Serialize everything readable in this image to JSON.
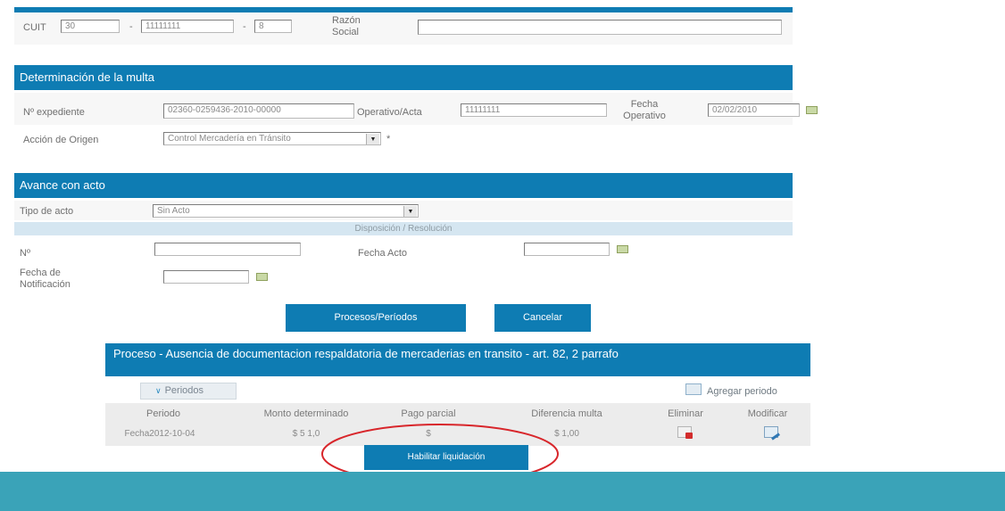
{
  "cuit_section": {
    "cuit_label": "CUIT",
    "cuit_part1": "30",
    "cuit_part2": "11111111",
    "cuit_part3": "8",
    "sep": "-",
    "razon_label": "Razón Social",
    "razon_value": ""
  },
  "multa_section": {
    "title": "Determinación de la multa",
    "expediente_label": "Nº expediente",
    "expediente_value": "02360-0259436-2010-00000",
    "operativo_label": "Operativo/Acta",
    "operativo_value": "11111111",
    "fecha_operativo_label": "Fecha Operativo",
    "fecha_operativo_value": "02/02/2010",
    "accion_label": "Acción de Origen",
    "accion_value": "Control Mercadería en Tránsito",
    "required_mark": "*"
  },
  "avance_section": {
    "title": "Avance con acto",
    "tipo_label": "Tipo de acto",
    "tipo_value": "Sin Acto",
    "subheader": "Disposición / Resolución",
    "numero_label": "Nº",
    "numero_value": "",
    "fecha_acto_label": "Fecha Acto",
    "fecha_acto_value": "",
    "fecha_notif_label": "Fecha de Notificación",
    "fecha_notif_value": ""
  },
  "actions": {
    "procesos_label": "Procesos/Períodos",
    "cancelar_label": "Cancelar"
  },
  "proceso_panel": {
    "title": "Proceso - Ausencia de documentacion respaldatoria de mercaderias en transito - art. 82, 2 parrafo",
    "periodos_toggle": "Periodos",
    "agregar_label": "Agregar periodo",
    "columns": [
      "Periodo",
      "Monto determinado",
      "Pago parcial",
      "Diferencia multa",
      "Eliminar",
      "Modificar"
    ],
    "rows": [
      {
        "periodo": "Fecha2012-10-04",
        "monto": "$ 5 1,0",
        "pago": "$",
        "diferencia": "$ 1,00"
      }
    ],
    "habilitar_label": "Habilitar liquidación"
  },
  "colors": {
    "header_blue": "#0e7cb3",
    "footer_teal": "#3aa3b8",
    "highlight_red": "#d8262b"
  }
}
